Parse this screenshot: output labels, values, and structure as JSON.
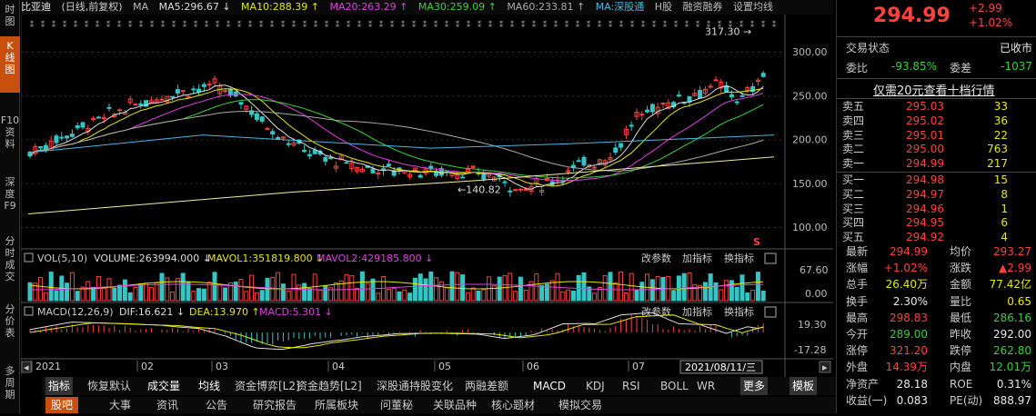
{
  "left_tabs": [
    {
      "label": "分时图",
      "lines": [
        "时",
        "图"
      ]
    },
    {
      "label": "K线图",
      "lines": [
        "K",
        "线",
        "图"
      ],
      "active": true
    },
    {
      "label": "F10资料",
      "lines": [
        "F10",
        "资",
        "料"
      ]
    },
    {
      "label": "深度F9",
      "lines": [
        "深",
        "度",
        "F9"
      ]
    },
    {
      "label": "分时成交",
      "lines": [
        "分",
        "时",
        "成",
        "交"
      ]
    },
    {
      "label": "分价表",
      "lines": [
        "分",
        "价",
        "表"
      ]
    },
    {
      "label": "多周期",
      "lines": [
        "多",
        "周",
        "期"
      ]
    }
  ],
  "header": {
    "stock_name": "比亚迪",
    "mode": "(日线,前复权)",
    "ma_label": "MA",
    "ma5": "MA5:296.67 ↓",
    "ma10": "MA10:288.39 ↑",
    "ma20": "MA20:263.29 ↑",
    "ma30": "MA30:259.09 ↑",
    "ma60": "MA60:233.81 ↑",
    "maidx": "MA:深股通",
    "hgu": "H股",
    "rzrq": "融资融券",
    "settings": "设置均线"
  },
  "main_chart": {
    "y_ticks": [
      "300.00",
      "250.00",
      "200.00",
      "150.00",
      "100.00"
    ],
    "high_label": "317.30",
    "low_label": "140.82",
    "s_marker": "S"
  },
  "vol_panel": {
    "title": "VOL(5,10)",
    "volume": "VOLUME:263994.000 ↓",
    "mavol1": "MAVOL1:351819.800 ↓",
    "mavol2": "MAVOL2:429185.800 ↓",
    "y_ticks": [
      "67.60",
      "0.00"
    ],
    "btn_params": "改参数",
    "btn_add": "加指标",
    "btn_switch": "换指标"
  },
  "macd_panel": {
    "title": "MACD(12,26,9)",
    "dif": "DIF:16.621 ↓",
    "dea": "DEA:13.970 ↑",
    "macd": "MACD:5.301 ↓",
    "y_ticks": [
      "19.30",
      "-17.28"
    ],
    "btn_params": "改参数",
    "btn_add": "加指标",
    "btn_switch": "换指标"
  },
  "x_axis": {
    "labels": [
      "2021",
      "02",
      "03",
      "04",
      "05",
      "06",
      "07"
    ],
    "date_box": "2021/08/11/三"
  },
  "indicator_tabs": [
    "指标",
    "恢复默认",
    "成交量",
    "均线",
    "资金博弈[L2]",
    "资金趋势[L2]",
    "深股通持股变化",
    "两融差额",
    "MACD",
    "KDJ",
    "RSI",
    "BOLL",
    "WR",
    "更多",
    "模板"
  ],
  "bottom_tabs": [
    "股吧",
    "大事",
    "资讯",
    "公告",
    "研究报告",
    "所属板块",
    "问董秘",
    "关联品种",
    "核心题材",
    "模拟交易"
  ],
  "quote": {
    "price": "294.99",
    "change": "+2.99",
    "change_pct": "+1.02%",
    "status_label": "交易状态",
    "status_value": "已收市",
    "wb_label": "委比",
    "wb_value": "-93.85%",
    "wc_label": "委差",
    "wc_value": "-1037",
    "promo": "仅需20元查看十档行情"
  },
  "orderbook": {
    "asks": [
      {
        "label": "卖五",
        "price": "295.03",
        "vol": "33"
      },
      {
        "label": "卖四",
        "price": "295.02",
        "vol": "36"
      },
      {
        "label": "卖三",
        "price": "295.01",
        "vol": "22"
      },
      {
        "label": "卖二",
        "price": "295.00",
        "vol": "763"
      },
      {
        "label": "卖一",
        "price": "294.99",
        "vol": "217"
      }
    ],
    "bids": [
      {
        "label": "买一",
        "price": "294.98",
        "vol": "15"
      },
      {
        "label": "买二",
        "price": "294.97",
        "vol": "8"
      },
      {
        "label": "买三",
        "price": "294.96",
        "vol": "1"
      },
      {
        "label": "买四",
        "price": "294.95",
        "vol": "6"
      },
      {
        "label": "买五",
        "price": "294.92",
        "vol": "4"
      }
    ]
  },
  "stats": [
    {
      "l1": "最新",
      "v1": "294.99",
      "c1": "red",
      "l2": "均价",
      "v2": "293.27",
      "c2": "red"
    },
    {
      "l1": "涨幅",
      "v1": "+1.02%",
      "c1": "red",
      "l2": "涨跌",
      "v2": "▲2.99",
      "c2": "red"
    },
    {
      "l1": "总手",
      "v1": "26.40万",
      "c1": "yellow",
      "l2": "金额",
      "v2": "77.42亿",
      "c2": "yellow"
    },
    {
      "l1": "换手",
      "v1": "2.30%",
      "c1": "white",
      "l2": "量比",
      "v2": "0.65",
      "c2": "yellow"
    },
    {
      "l1": "最高",
      "v1": "298.83",
      "c1": "red",
      "l2": "最低",
      "v2": "286.16",
      "c2": "green"
    },
    {
      "l1": "今开",
      "v1": "289.00",
      "c1": "green",
      "l2": "昨收",
      "v2": "292.00",
      "c2": "white"
    },
    {
      "l1": "涨停",
      "v1": "321.20",
      "c1": "red",
      "l2": "跌停",
      "v2": "262.80",
      "c2": "green"
    },
    {
      "l1": "外盘",
      "v1": "14.39万",
      "c1": "red",
      "l2": "内盘",
      "v2": "12.01万",
      "c2": "green"
    },
    {
      "l1": "净资产",
      "v1": "28.18",
      "c1": "white",
      "l2": "ROE",
      "v2": "0.31%",
      "c2": "white"
    },
    {
      "l1": "收益(一)",
      "v1": "0.083",
      "c1": "white",
      "l2": "PE(动)",
      "v2": "888.97",
      "c2": "white"
    }
  ],
  "colors": {
    "up": "#ff4040",
    "down": "#34c6c6",
    "ma5": "#dddddd",
    "ma10": "#e8e800",
    "ma20": "#e040e0",
    "ma30": "#3cd23c",
    "ma60": "#aaaaaa",
    "ma120": "#4ab8e0",
    "ma250": "#f0f0a0",
    "accent": "#c8500c"
  }
}
